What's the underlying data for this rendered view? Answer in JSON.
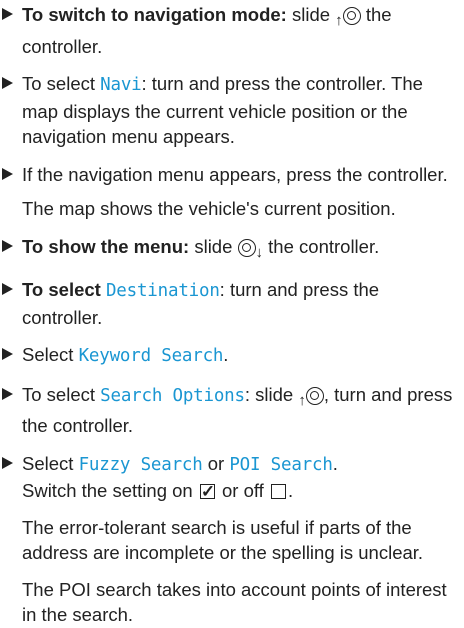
{
  "steps": [
    {
      "bold": "To switch to navigation mode:",
      "t1": "slide",
      "t2": "the controller."
    },
    {
      "t1": "To select",
      "ui": "Navi",
      "t2": ": turn and press the controller. The map displays the current vehicle position or the navigation menu appears."
    },
    {
      "t1": "If the navigation menu appears, press the controller.",
      "result": "The map shows the vehicle's current position."
    },
    {
      "bold": "To show the menu:",
      "t1": "slide",
      "t2": "the controller."
    },
    {
      "bold": "To select",
      "ui": "Destination",
      "t2": ": turn and press the controller."
    },
    {
      "t1": "Select",
      "ui": "Keyword Search",
      "t2": "."
    },
    {
      "t1": "To select",
      "ui": "Search Options",
      "t2": ": slide",
      "t3": ", turn and press the controller."
    },
    {
      "t1": "Select",
      "ui1": "Fuzzy Search",
      "mid": "or",
      "ui2": "POI Search",
      "t2": ".",
      "switch_on": "Switch the setting on",
      "switch_off": "or off",
      "switch_end": ".",
      "p1": "The error-tolerant search is useful if parts of the address are incomplete or the spelling is unclear.",
      "p2": "The POI search takes into account points of interest in the search."
    }
  ],
  "icons": {
    "up_arrow": "↑",
    "down_arrow": "↓",
    "check": "✓"
  },
  "colors": {
    "ui_text": "#1a96d2",
    "body_text": "#222222"
  }
}
